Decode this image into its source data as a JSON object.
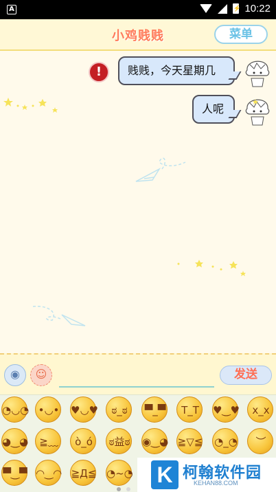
{
  "status_bar": {
    "time": "10:22",
    "battery": "⚡"
  },
  "header": {
    "title": "小鸡贱贱",
    "menu_label": "菜单"
  },
  "messages": [
    {
      "text": "贱贱，今天星期几",
      "side": "right",
      "error": true,
      "error_glyph": "!"
    },
    {
      "text": "人呢",
      "side": "right",
      "error": false
    }
  ],
  "input_bar": {
    "voice_icon": "voice-wave-icon",
    "voice_glyph": "◉",
    "emoji_icon": "smiley-icon",
    "emoji_glyph": "☺",
    "message_value": "",
    "message_placeholder": "",
    "send_label": "发送"
  },
  "emoji_panel": {
    "rows": [
      [
        "◔◡◔",
        "•◡•",
        "♥◡♥",
        "ಠ_ಠ",
        "▀̿_▀̿",
        "T_T",
        "♥‿♥",
        "x_x"
      ],
      [
        "◕‿◕",
        "≧﹏≦",
        "ò_ó",
        "ಠ益ಠ",
        "◉‿◕",
        "≧▽≦",
        "◔_◔",
        "︶︿︶"
      ],
      [
        "▀̿‿▀̿",
        "◠‿◠",
        "≧Д≦",
        "◔~◔"
      ]
    ],
    "page_count": 2,
    "active_page": 1
  },
  "watermark": {
    "logo": "K",
    "text": "柯翰软件园",
    "sub": "KEHAN88.COM"
  },
  "colors": {
    "accent": "#ff7c5a",
    "bubble": "#d8e8fb",
    "background": "#fffaeb",
    "error": "#c41f24"
  }
}
